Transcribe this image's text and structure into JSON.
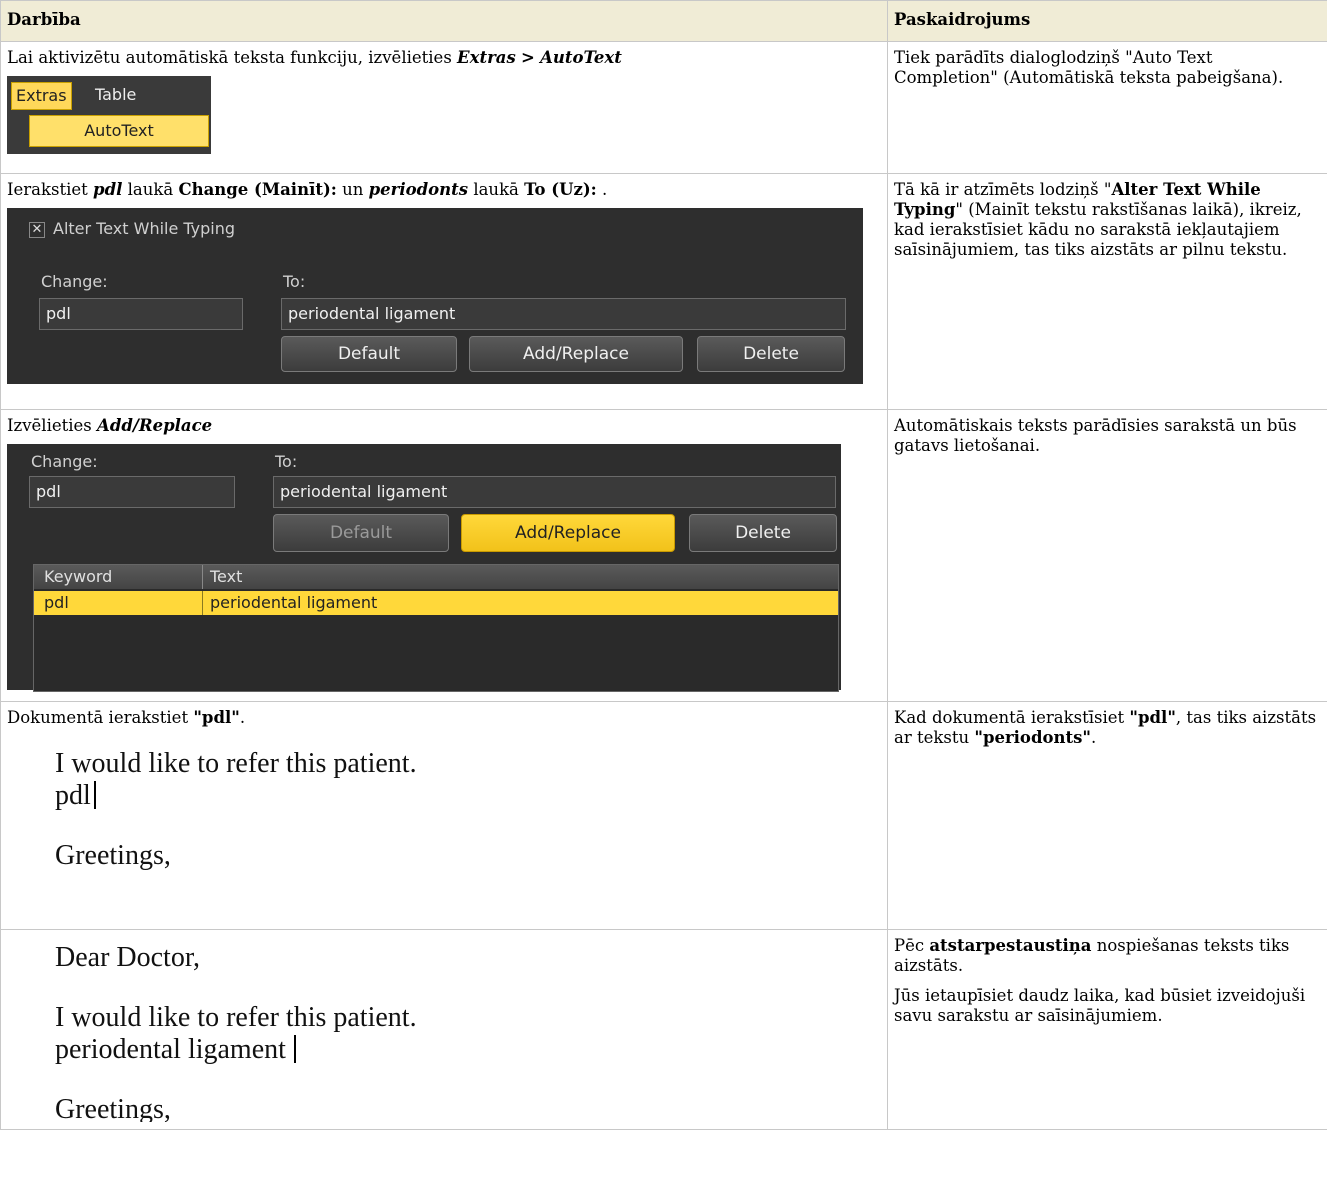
{
  "header": {
    "col1": "Darbība",
    "col2": "Paskaidrojums"
  },
  "rows": [
    {
      "action_html": "Lai aktivizētu automātiskā teksta funkciju, izvēlieties <b><i>Extras</i></b> <b>&gt;</b> <b><i>AutoText</i></b>",
      "explain_html": [
        "Tiek parādīts dialoglodziņš \"Auto Text Completion\" (Automātiskā teksta pabeigšana)."
      ]
    },
    {
      "action_html": "Ierakstiet <b><i>pdl</i></b> laukā <b>Change (Mainīt):</b> un <b><i>periodonts</i></b> laukā <b>To (Uz):</b> .",
      "explain_html": [
        "Tā kā ir atzīmēts lodziņš \"<b>Alter Text While Typing</b>\" (Mainīt tekstu rakstīšanas laikā), ikreiz, kad ierakstīsiet kādu no sarakstā iekļautajiem saīsinājumiem, tas tiks aizstāts ar pilnu tekstu."
      ]
    },
    {
      "action_html": "Izvēlieties <b><i>Add/Replace</i></b>",
      "explain_html": [
        "Automātiskais teksts parādīsies sarakstā un būs gatavs lietošanai."
      ]
    },
    {
      "action_html": "Dokumentā ierakstiet <b>\"pdl\"</b>.",
      "explain_html": [
        "Kad dokumentā ierakstīsiet <b>\"pdl\"</b>, tas tiks aizstāts ar tekstu <b>\"periodonts\"</b>."
      ]
    },
    {
      "action_html": "",
      "explain_html": [
        "Pēc <b>atstarpestaustiņa</b> nospiešanas teksts tiks aizstāts.",
        "Jūs ietaupīsiet daudz laika, kad būsiet izveidojuši savu sarakstu ar saīsinājumiem."
      ]
    }
  ],
  "menu_shot": {
    "menu1": "Extras",
    "menu2": "Table",
    "item": "AutoText"
  },
  "dialog1": {
    "checkbox_label": "Alter Text While Typing",
    "change_label": "Change:",
    "to_label": "To:",
    "change_value": "pdl",
    "to_value": "periodental ligament",
    "btn_default": "Default",
    "btn_add": "Add/Replace",
    "btn_delete": "Delete"
  },
  "dialog2": {
    "change_label": "Change:",
    "to_label": "To:",
    "change_value": "pdl",
    "to_value": "periodental ligament",
    "btn_default": "Default",
    "btn_add": "Add/Replace",
    "btn_delete": "Delete",
    "col_keyword": "Keyword",
    "col_text": "Text",
    "row_keyword": "pdl",
    "row_text": "periodental ligament"
  },
  "letter1": {
    "line1": "I would like to refer this patient.",
    "line2": "pdl",
    "line3": "Greetings,"
  },
  "letter2": {
    "line1": "Dear Doctor,",
    "line2": "I would like to refer this patient.",
    "line3": "periodental ligament",
    "line4": "Greetings,"
  },
  "colors": {
    "header_bg": "#f0ecd6",
    "highlight": "#ffd83a",
    "dark_bg": "#2e2e2e"
  }
}
